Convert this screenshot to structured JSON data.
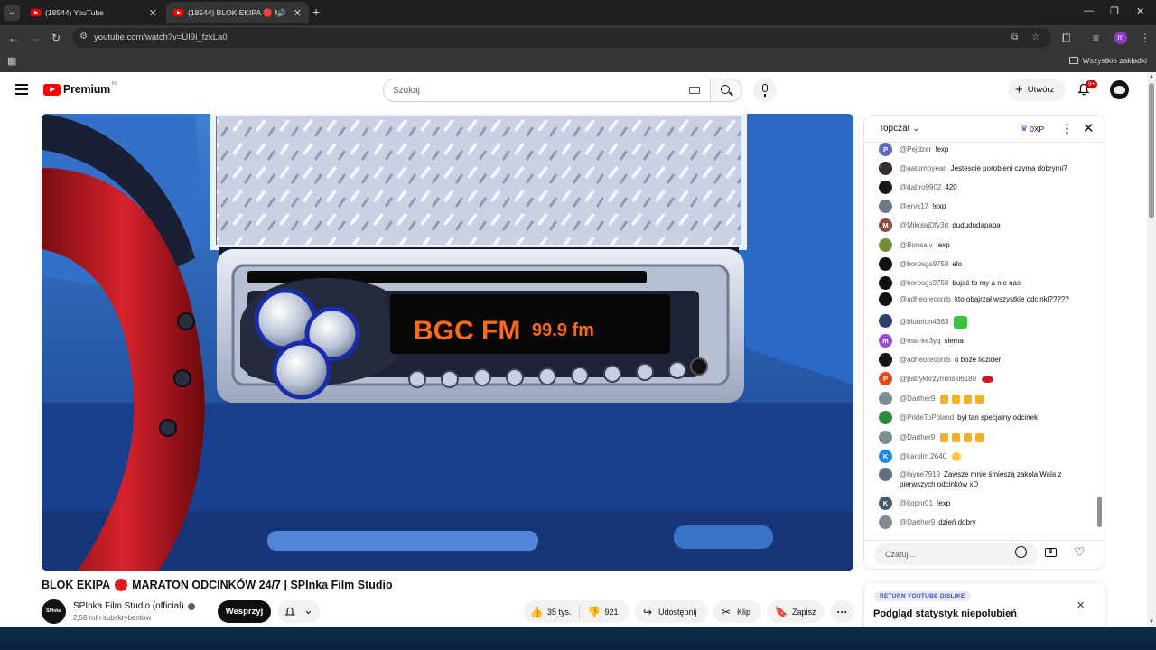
{
  "browser": {
    "tabs": [
      {
        "title": "(18544) YouTube",
        "active": false
      },
      {
        "title": "(18544) BLOK EKIPA 🔴 MA",
        "active": true
      }
    ],
    "url": "youtube.com/watch?v=UI9i_fzkLa0",
    "profile_initial": "m",
    "all_bookmarks_label": "Wszystkie zakładki"
  },
  "yt_header": {
    "logo_text": "Premium",
    "region": "PL",
    "search_placeholder": "Szukaj",
    "create_label": "Utwórz",
    "notification_count": "9+"
  },
  "player": {
    "radio_brand": "BGC FM",
    "radio_freq": "99.9 fm"
  },
  "video": {
    "title_left": "BLOK EKIPA",
    "title_right": "MARATON ODCINKÓW 24/7 | SPInka Film Studio",
    "channel_name": "SPInka Film Studio (official)",
    "channel_avatar_text": "SPInka",
    "subscribers": "2,58 mln subskrybentów",
    "support_label": "Wesprzyj",
    "likes": "35 tys.",
    "dislikes": "921",
    "share_label": "Udostępnij",
    "clip_label": "Klip",
    "save_label": "Zapisz"
  },
  "chat": {
    "mode": "Topczat",
    "xp": "0XP",
    "input_placeholder": "Czatuj...",
    "messages": [
      {
        "author": "@Pejdzer",
        "text": "!exp",
        "avatar_letter": "P",
        "avatar_color": "#5c6bc0",
        "emojis": []
      },
      {
        "author": "@aaturnoyean",
        "text": "Jestescie porobieni czyma dobrymi?",
        "avatar_letter": "",
        "avatar_color": "#3b2a2a",
        "emojis": []
      },
      {
        "author": "@dabro9902",
        "text": "420",
        "avatar_letter": "",
        "avatar_color": "#1a1a1a",
        "emojis": []
      },
      {
        "author": "@ervk17",
        "text": "!exp",
        "avatar_letter": "",
        "avatar_color": "#6d7a8a",
        "emojis": []
      },
      {
        "author": "@MikolajDfy3rt",
        "text": "dudududapapa",
        "avatar_letter": "M",
        "avatar_color": "#8d4a3f",
        "emojis": []
      },
      {
        "author": "@Bonsaiv",
        "text": "!exp",
        "avatar_letter": "",
        "avatar_color": "#6f8f3a",
        "emojis": []
      },
      {
        "author": "@borosgs9758",
        "text": "elo",
        "avatar_letter": "",
        "avatar_color": "#111111",
        "emojis": []
      },
      {
        "author": "@borosgs9758",
        "text": "bujać to my a nie nas",
        "avatar_letter": "",
        "avatar_color": "#111111",
        "emojis": []
      },
      {
        "author": "@adheorecords",
        "text": "kto obajrzał wszystkie odcinki?????",
        "avatar_letter": "",
        "avatar_color": "#151515",
        "emojis": []
      },
      {
        "author": "@bluorion4363",
        "text": "",
        "avatar_letter": "",
        "avatar_color": "#2a3f6b",
        "emojis": [
          "frog"
        ]
      },
      {
        "author": "@mat-ke3yq",
        "text": "siema",
        "avatar_letter": "m",
        "avatar_color": "#9c47d6",
        "emojis": []
      },
      {
        "author": "@adheorecords",
        "text": "o boże liczider",
        "avatar_letter": "",
        "avatar_color": "#151515",
        "emojis": []
      },
      {
        "author": "@patrykkrzyminski6180",
        "text": "",
        "avatar_letter": "P",
        "avatar_color": "#e64a19",
        "emojis": [
          "lips"
        ]
      },
      {
        "author": "@Darther9",
        "text": "",
        "avatar_letter": "",
        "avatar_color": "#7e8c96",
        "emojis": [
          "beer",
          "beer",
          "beer",
          "beer"
        ]
      },
      {
        "author": "@PrideToPoland",
        "text": "był tan specjalny odcinek",
        "avatar_letter": "",
        "avatar_color": "#2e8b3e",
        "emojis": []
      },
      {
        "author": "@Darther9",
        "text": "",
        "avatar_letter": "",
        "avatar_color": "#7e8c96",
        "emojis": [
          "beer",
          "beer",
          "beer",
          "beer"
        ]
      },
      {
        "author": "@karolm.2640",
        "text": "",
        "avatar_letter": "K",
        "avatar_color": "#1e88e5",
        "emojis": [
          "laugh"
        ]
      },
      {
        "author": "@layne7919",
        "text": "Zawsze mnie śmieszą zakola Wala z pierwszych odcinków xD",
        "avatar_letter": "",
        "avatar_color": "#5f6f7e",
        "emojis": []
      },
      {
        "author": "@kopnr01",
        "text": "!exp",
        "avatar_letter": "K",
        "avatar_color": "#455a64",
        "emojis": []
      },
      {
        "author": "@Darther9",
        "text": "dzień dobry",
        "avatar_letter": "",
        "avatar_color": "#7e8c96",
        "emojis": []
      }
    ]
  },
  "ryd_popup": {
    "badge": "RETURN YOUTUBE DISLIKE",
    "title": "Podgląd statystyk niepolubień"
  }
}
